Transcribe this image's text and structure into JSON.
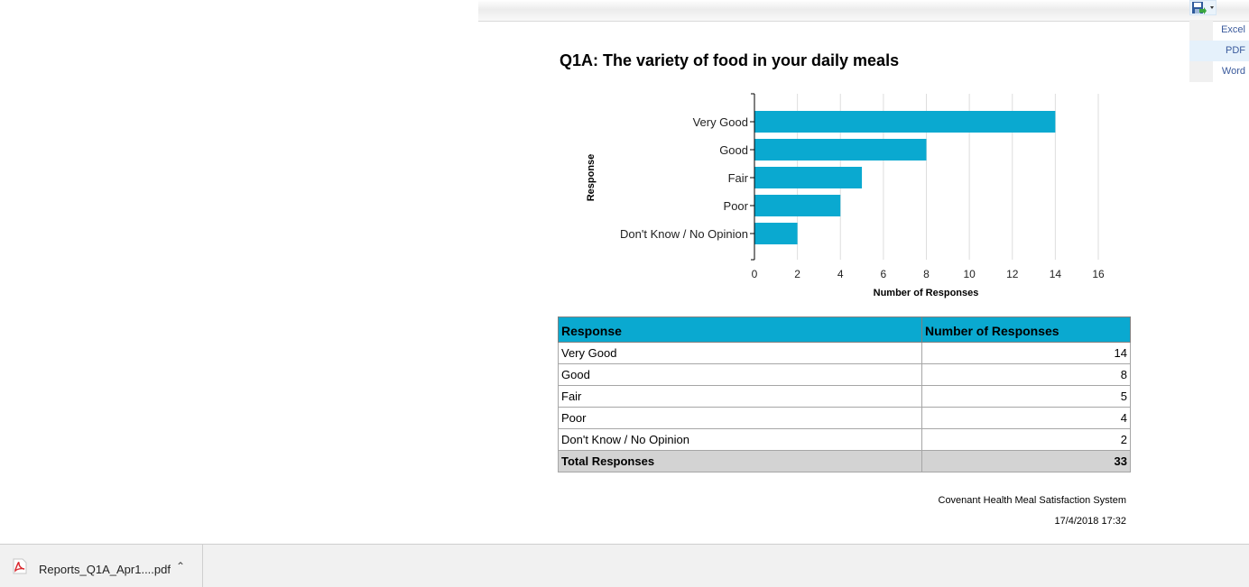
{
  "toolbar": {
    "export_menu": [
      "Excel",
      "PDF",
      "Word"
    ]
  },
  "report": {
    "title": "Q1A: The variety of food in your daily meals",
    "table": {
      "headers": [
        "Response",
        "Number of Responses"
      ],
      "rows": [
        {
          "response": "Very Good",
          "count": "14"
        },
        {
          "response": "Good",
          "count": "8"
        },
        {
          "response": "Fair",
          "count": "5"
        },
        {
          "response": "Poor",
          "count": "4"
        },
        {
          "response": "Don't Know / No Opinion",
          "count": "2"
        }
      ],
      "total_label": "Total Responses",
      "total_value": "33"
    },
    "footer": {
      "system": "Covenant Health Meal Satisfaction System",
      "timestamp": "17/4/2018 17:32"
    }
  },
  "chart_data": {
    "type": "bar",
    "orientation": "horizontal",
    "categories": [
      "Very Good",
      "Good",
      "Fair",
      "Poor",
      "Don't Know / No Opinion"
    ],
    "values": [
      14,
      8,
      5,
      4,
      2
    ],
    "xlabel": "Number of Responses",
    "ylabel": "Response",
    "xlim": [
      0,
      16
    ],
    "xticks": [
      0,
      2,
      4,
      6,
      8,
      10,
      12,
      14,
      16
    ],
    "grid": true,
    "bar_color": "#0aa9d0"
  },
  "download_bar": {
    "file_name": "Reports_Q1A_Apr1....pdf",
    "icon": "pdf-file-icon"
  },
  "colors": {
    "accent": "#0aa9d0",
    "total_row": "#d3d3d3"
  }
}
